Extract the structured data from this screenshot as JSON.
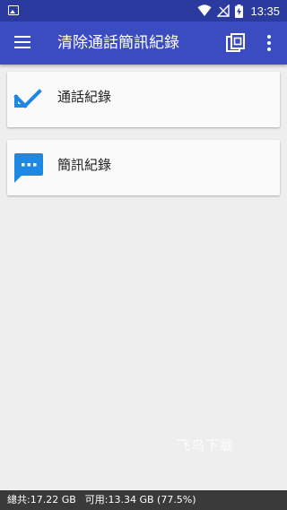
{
  "status_bar": {
    "time": "13:35",
    "icons": [
      "image-icon",
      "wifi-icon",
      "no-signal-icon",
      "battery-charging-icon"
    ]
  },
  "app_bar": {
    "title": "清除通話簡訊紀錄",
    "icons": [
      "menu-icon",
      "copy-icon",
      "more-vert-icon"
    ]
  },
  "cards": [
    {
      "label": "通話紀錄",
      "icon": "call-received-icon"
    },
    {
      "label": "簡訊紀錄",
      "icon": "sms-icon"
    }
  ],
  "watermark": "飞鸟下载",
  "storage": {
    "total": "總共:17.22 GB",
    "available": "可用:13.34 GB (77.5%)"
  },
  "colors": {
    "status_bar": "#2a3a9e",
    "app_bar": "#3b4cc0",
    "accent_blue": "#1e88e5",
    "background": "#eeeeee",
    "bottom_bar": "#3a3a3a"
  }
}
